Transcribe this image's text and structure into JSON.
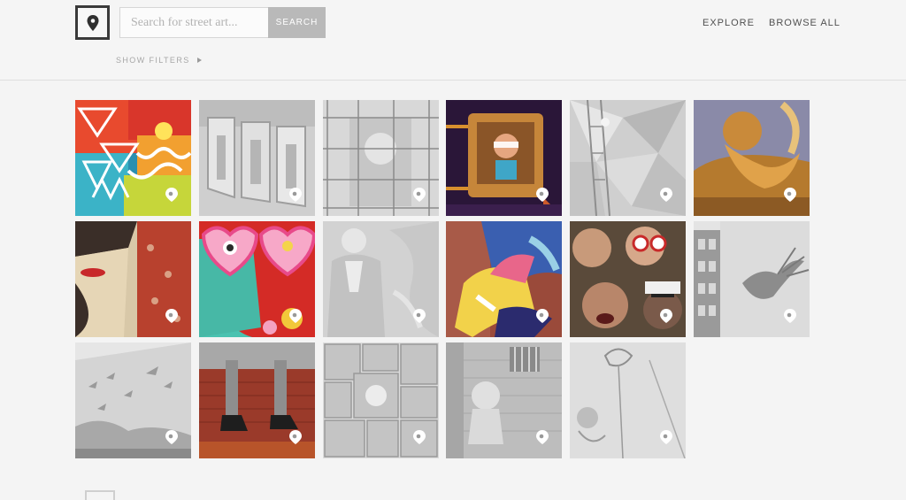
{
  "header": {
    "logo_icon": "map-pin-icon",
    "search": {
      "placeholder": "Search for street art...",
      "value": "",
      "button_label": "SEARCH"
    },
    "nav": [
      {
        "label": "EXPLORE"
      },
      {
        "label": "BROWSE ALL"
      }
    ],
    "filters_label": "SHOW FILTERS"
  },
  "gallery": {
    "tiles": [
      {
        "subject": "geometric triangles mural",
        "color": "color"
      },
      {
        "subject": "block letters wall",
        "color": "grayscale"
      },
      {
        "subject": "scaffolding figure mural",
        "color": "grayscale"
      },
      {
        "subject": "retro tv face mural",
        "color": "color"
      },
      {
        "subject": "climber faceted wall",
        "color": "grayscale"
      },
      {
        "subject": "golden angel figure",
        "color": "color"
      },
      {
        "subject": "woman red lips poster",
        "color": "color"
      },
      {
        "subject": "heart glasses face",
        "color": "color"
      },
      {
        "subject": "george washington mural",
        "color": "grayscale"
      },
      {
        "subject": "abstract hands mural",
        "color": "color"
      },
      {
        "subject": "crowd faces mural",
        "color": "color"
      },
      {
        "subject": "bird on building",
        "color": "grayscale"
      },
      {
        "subject": "birds wall mural",
        "color": "grayscale"
      },
      {
        "subject": "legs with boots",
        "color": "color"
      },
      {
        "subject": "comic collage",
        "color": "grayscale"
      },
      {
        "subject": "astronaut alley",
        "color": "grayscale"
      },
      {
        "subject": "sketch lines wall",
        "color": "grayscale"
      }
    ],
    "tile_icon": "location-pin-icon"
  }
}
